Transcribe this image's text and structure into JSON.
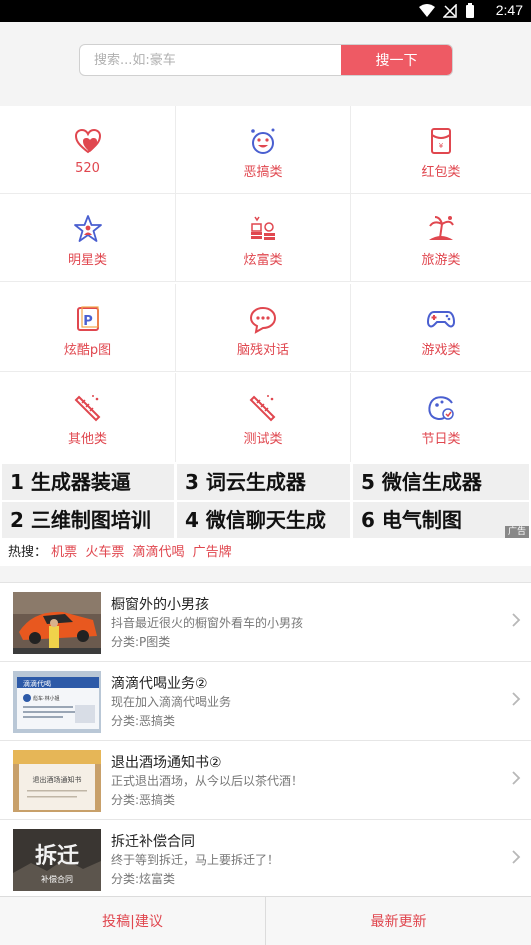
{
  "status": {
    "time": "2:47"
  },
  "search": {
    "placeholder": "搜索...如:豪车",
    "button": "搜一下"
  },
  "categories": [
    {
      "label": "520",
      "icon": "heart-icon"
    },
    {
      "label": "恶搞类",
      "icon": "funny-face-icon"
    },
    {
      "label": "红包类",
      "icon": "red-envelope-icon"
    },
    {
      "label": "明星类",
      "icon": "star-person-icon"
    },
    {
      "label": "炫富类",
      "icon": "money-stack-icon"
    },
    {
      "label": "旅游类",
      "icon": "beach-icon"
    },
    {
      "label": "炫酷p图",
      "icon": "p-box-icon"
    },
    {
      "label": "脑残对话",
      "icon": "chat-bubble-icon"
    },
    {
      "label": "游戏类",
      "icon": "gamepad-icon"
    },
    {
      "label": "其他类",
      "icon": "wand-icon"
    },
    {
      "label": "测试类",
      "icon": "wand-icon"
    },
    {
      "label": "节日类",
      "icon": "holiday-icon"
    }
  ],
  "tags": [
    {
      "label": "1 生成器装逼"
    },
    {
      "label": "3 词云生成器"
    },
    {
      "label": "5 微信生成器"
    },
    {
      "label": "2 三维制图培训"
    },
    {
      "label": "4 微信聊天生成"
    },
    {
      "label": "6 电气制图"
    }
  ],
  "ad_badge": "广告",
  "hot": {
    "prefix": "热搜：",
    "items": [
      "机票",
      "火车票",
      "滴滴代喝",
      "广告牌"
    ]
  },
  "list": [
    {
      "title": "橱窗外的小男孩",
      "desc": "抖音最近很火的橱窗外看车的小男孩",
      "category": "分类:P图类"
    },
    {
      "title": "滴滴代喝业务②",
      "desc": "现在加入滴滴代喝业务",
      "category": "分类:恶搞类"
    },
    {
      "title": "退出酒场通知书②",
      "desc": "正式退出酒场，从今以后以茶代酒！",
      "category": "分类:恶搞类"
    },
    {
      "title": "拆迁补偿合同",
      "desc": "终于等到拆迁，马上要拆迁了！",
      "category": "分类:炫富类"
    }
  ],
  "thumb_text": {
    "didi_sign": "滴滴代喝",
    "didi_sub": "彪车·林小姐",
    "notice_text": "退出酒场通知书",
    "chaiqian_big": "拆迁",
    "chaiqian_small": "补偿合同"
  },
  "footer": {
    "left": "投稿|建议",
    "right": "最新更新"
  },
  "colors": {
    "accent": "#ee5a64",
    "label_red": "#e0474f",
    "icon_blue": "#4a5fd0"
  }
}
